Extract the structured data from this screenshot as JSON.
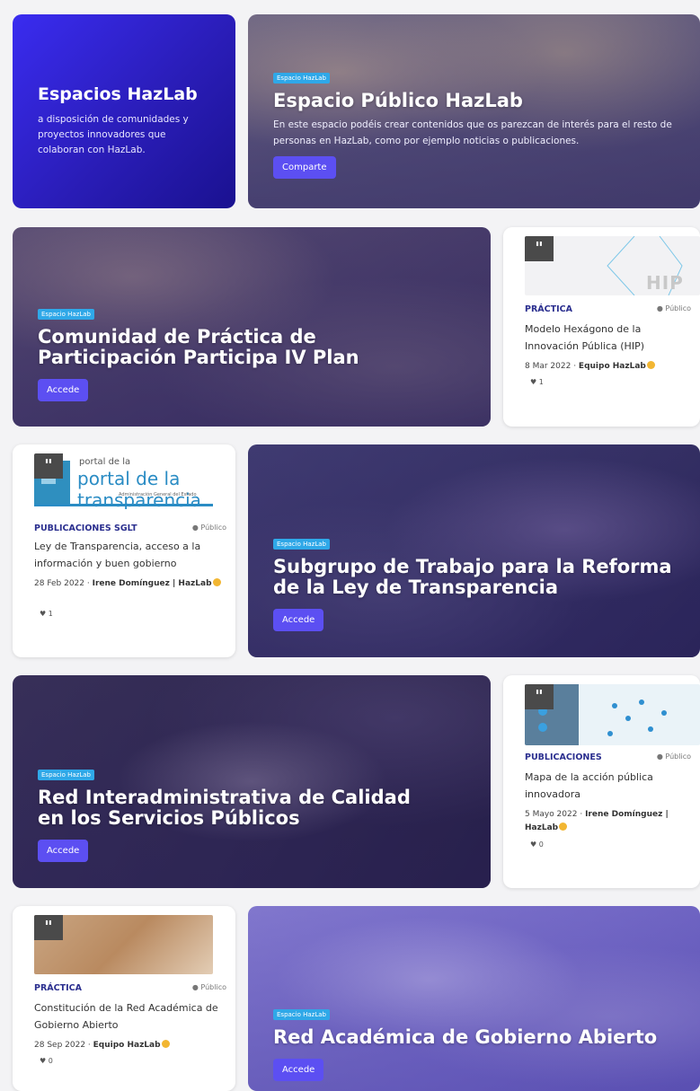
{
  "intro": {
    "title": "Espacios HazLab",
    "text": "a disposición de comunidades y proyectos innovadores que colaboran con HazLab."
  },
  "heroes": [
    {
      "tag": "Espacio HazLab",
      "title": "Espacio Público HazLab",
      "desc": "En este espacio podéis crear contenidos que os parezcan de interés para el resto de personas en HazLab, como por ejemplo noticias o publicaciones.",
      "button": "Comparte"
    },
    {
      "tag": "Espacio HazLab",
      "title": "Comunidad de Práctica de Participación  Participa IV Plan",
      "button": "Accede"
    },
    {
      "tag": "Espacio HazLab",
      "title": "Subgrupo de Trabajo para la Reforma de la Ley de Transparencia",
      "button": "Accede"
    },
    {
      "tag": "Espacio HazLab",
      "title": "Red Interadministrativa de Calidad en los Servicios Públicos",
      "button": "Accede"
    },
    {
      "tag": "Espacio HazLab",
      "title": "Red Académica de Gobierno Abierto",
      "button": "Accede"
    }
  ],
  "posts": [
    {
      "category": "PRÁCTICA",
      "visibility": "Público",
      "title": "Modelo Hexágono de la Innovación Pública (HIP)",
      "date": "8 Mar 2022 · ",
      "author": "Equipo HazLab",
      "likes": "1",
      "thumb_text": "HIP"
    },
    {
      "category": "PUBLICACIONES SGLT",
      "visibility": "Público",
      "title": "Ley de Transparencia, acceso a la información y buen gobierno",
      "date": "28 Feb 2022 · ",
      "author": "Irene Domínguez | HazLab",
      "likes": "1",
      "thumb_text": "portal de la transparencia",
      "thumb_sub": "Administración General del Estado"
    },
    {
      "category": "PUBLICACIONES",
      "visibility": "Público",
      "title": "Mapa de la acción pública innovadora",
      "date": "5 Mayo 2022 · ",
      "author": "Irene Domínguez | HazLab",
      "likes": "0"
    },
    {
      "category": "PRÁCTICA",
      "visibility": "Público",
      "title": "Constitución de la Red Académica de Gobierno Abierto",
      "date": "28 Sep 2022 · ",
      "author": "Equipo HazLab",
      "likes": "0"
    }
  ],
  "icons": {
    "quote": "quote-icon",
    "heart": "heart-icon",
    "globe": "globe-icon",
    "verified": "verified-badge-icon"
  },
  "colors": {
    "accent": "#5c4ff2",
    "tag": "#2fa8e8",
    "category": "#2b2f8f"
  }
}
